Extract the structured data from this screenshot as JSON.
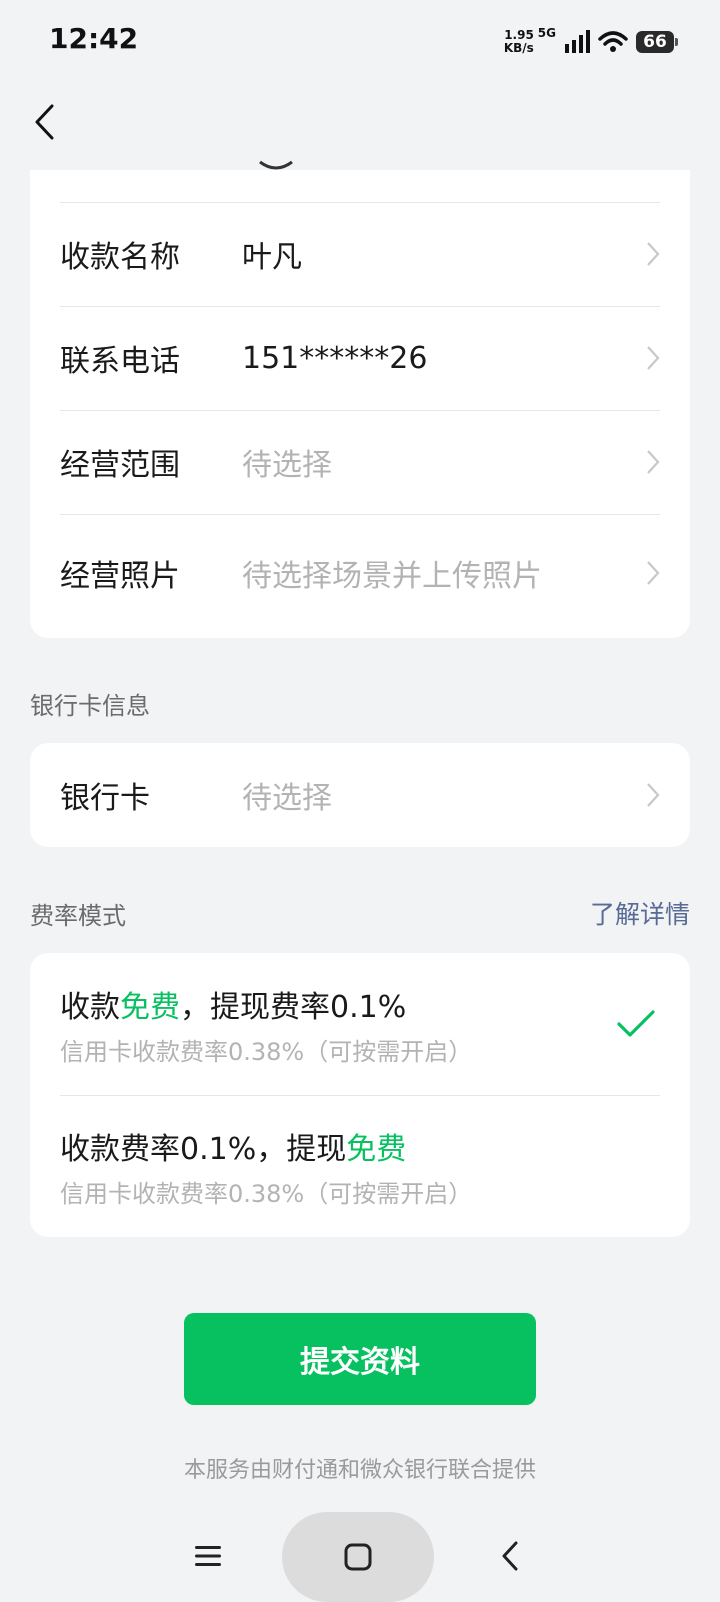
{
  "status_bar": {
    "time": "12:42",
    "net_speed_top": "1.95",
    "net_speed_bottom": "KB/s",
    "network": "5G",
    "battery": "66"
  },
  "merchant": {
    "rows": [
      {
        "label": "收款名称",
        "value": "叶凡",
        "placeholder": false
      },
      {
        "label": "联系电话",
        "value": "151******26",
        "placeholder": false
      },
      {
        "label": "经营范围",
        "value": "待选择",
        "placeholder": true
      },
      {
        "label": "经营照片",
        "value": "待选择场景并上传照片",
        "placeholder": true
      }
    ]
  },
  "bank": {
    "section_title": "银行卡信息",
    "row": {
      "label": "银行卡",
      "value": "待选择"
    }
  },
  "fee": {
    "section_title": "费率模式",
    "learn_more": "了解详情",
    "options": [
      {
        "part1": "收款",
        "green": "免费",
        "part2": "，提现费率0.1%",
        "sub": "信用卡收款费率0.38%（可按需开启）",
        "selected": true
      },
      {
        "part1": "收款费率0.1%，提现",
        "green": "免费",
        "part2": "",
        "sub": "信用卡收款费率0.38%（可按需开启）",
        "selected": false
      }
    ]
  },
  "submit_label": "提交资料",
  "footer_note": "本服务由财付通和微众银行联合提供",
  "colors": {
    "accent": "#07c160",
    "link": "#576b95",
    "background": "#f2f3f5"
  },
  "icons": [
    "back-icon",
    "chevron-right-icon",
    "checkmark-icon",
    "menu-icon",
    "home-icon",
    "nav-back-icon",
    "signal-icon",
    "wifi-icon",
    "battery-icon"
  ]
}
